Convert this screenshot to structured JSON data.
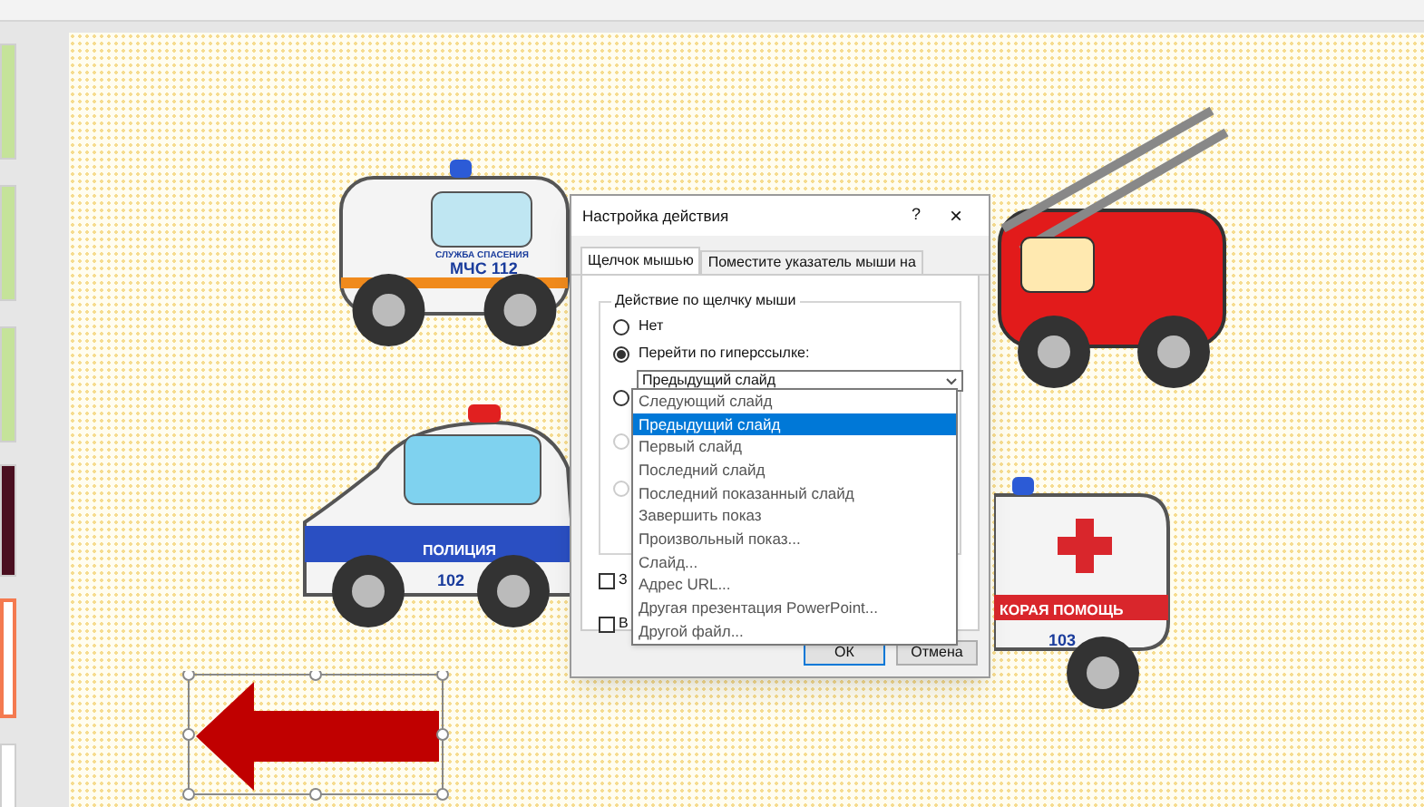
{
  "thumbnails": [
    {
      "kind": "green",
      "selected": false
    },
    {
      "kind": "green",
      "selected": false
    },
    {
      "kind": "green",
      "selected": false
    },
    {
      "kind": "dark",
      "selected": false
    },
    {
      "kind": "blank",
      "selected": true
    },
    {
      "kind": "blank",
      "selected": false
    }
  ],
  "vehicles": [
    {
      "kind": "ambulance",
      "labels": [
        "СЛУЖБА СПАСЕНИЯ",
        "МЧС 112"
      ]
    },
    {
      "kind": "fire"
    },
    {
      "kind": "police",
      "labels": [
        "ПОЛИЦИЯ",
        "102"
      ]
    },
    {
      "kind": "ambulance2",
      "labels": [
        "КОРАЯ ПОМОЩЬ",
        "103"
      ]
    }
  ],
  "dialog": {
    "title": "Настройка действия",
    "help": "?",
    "close": "×",
    "tabs": [
      {
        "label": "Щелчок мышью",
        "selected": true
      },
      {
        "label": "Поместите указатель мыши на",
        "selected": false
      }
    ],
    "group_title": "Действие по щелчку мыши",
    "options": [
      {
        "label": "Нет",
        "selected": false
      },
      {
        "label": "Перейти по гиперссылке:",
        "selected": true
      }
    ],
    "hidden_options": [
      {
        "selected": false,
        "disabled": false
      },
      {
        "selected": false,
        "disabled": true
      },
      {
        "selected": false,
        "disabled": true
      }
    ],
    "hyperlink_select": {
      "value": "Предыдущий слайд",
      "items": [
        {
          "label": "Следующий слайд",
          "selected": false
        },
        {
          "label": "Предыдущий слайд",
          "selected": true
        },
        {
          "label": "Первый слайд",
          "selected": false
        },
        {
          "label": "Последний слайд",
          "selected": false
        },
        {
          "label": "Последний показанный слайд",
          "selected": false
        },
        {
          "label": "Завершить показ",
          "selected": false
        },
        {
          "label": "Произвольный показ...",
          "selected": false
        },
        {
          "label": "Слайд...",
          "selected": false
        },
        {
          "label": "Адрес URL...",
          "selected": false
        },
        {
          "label": "Другая презентация PowerPoint...",
          "selected": false
        },
        {
          "label": "Другой файл...",
          "selected": false
        }
      ]
    },
    "checkboxes": [
      {
        "label": "З",
        "checked": false
      },
      {
        "label": "В",
        "checked": false
      }
    ],
    "buttons": [
      "ОК",
      "Отмена"
    ]
  }
}
